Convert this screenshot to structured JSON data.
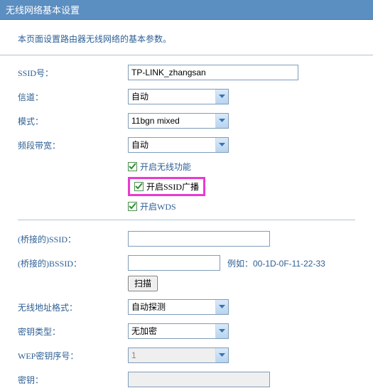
{
  "title": "无线网络基本设置",
  "instruction": "本页面设置路由器无线网络的基本参数。",
  "fields": {
    "ssid_label": "SSID号：",
    "ssid_value": "TP-LINK_zhangsan",
    "channel_label": "信道：",
    "channel_value": "自动",
    "mode_label": "模式：",
    "mode_value": "11bgn mixed",
    "bandwidth_label": "频段带宽：",
    "bandwidth_value": "自动"
  },
  "checkboxes": {
    "enable_wireless": "开启无线功能",
    "enable_ssid_broadcast": "开启SSID广播",
    "enable_wds": "开启WDS"
  },
  "wds": {
    "bridge_ssid_label": "(桥接的)SSID：",
    "bridge_ssid_value": "",
    "bridge_bssid_label": "(桥接的)BSSID：",
    "bridge_bssid_value": "",
    "bssid_hint": "例如：00-1D-0F-11-22-33",
    "scan_button": "扫描",
    "addr_format_label": "无线地址格式：",
    "addr_format_value": "自动探测",
    "key_type_label": "密钥类型：",
    "key_type_value": "无加密",
    "wep_index_label": "WEP密钥序号：",
    "wep_index_value": "1",
    "key_label": "密钥：",
    "key_value": ""
  }
}
